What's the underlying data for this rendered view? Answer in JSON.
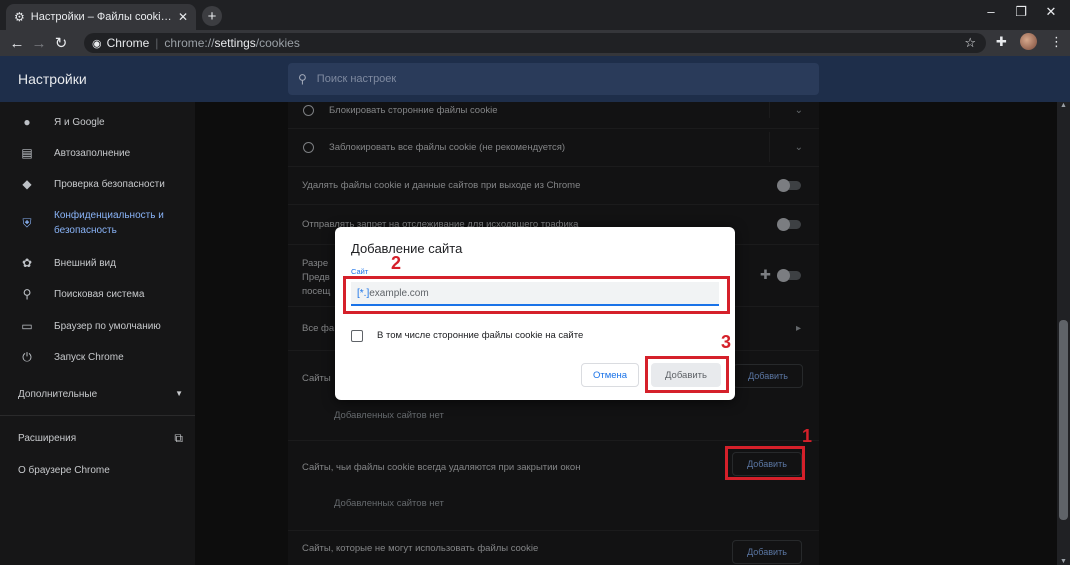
{
  "browser": {
    "tab_title": "Настройки – Файлы cookie и др",
    "tab_icon": "gear-icon",
    "new_tab_label": "+",
    "site_name": "Chrome",
    "url_prefix": "chrome://",
    "url_host": "settings",
    "url_path": "/cookies",
    "window_controls": [
      "–",
      "❐",
      "✕"
    ]
  },
  "settings": {
    "title": "Настройки",
    "search_placeholder": "Поиск настроек"
  },
  "sidebar": {
    "items": [
      {
        "label": "Я и Google",
        "icon": "person-icon"
      },
      {
        "label": "Автозаполнение",
        "icon": "clipboard-icon"
      },
      {
        "label": "Проверка безопасности",
        "icon": "shield-check-icon"
      },
      {
        "label": "Конфиденциальность и безопасность",
        "icon": "shield-icon",
        "active": true
      },
      {
        "label": "Внешний вид",
        "icon": "palette-icon"
      },
      {
        "label": "Поисковая система",
        "icon": "search-icon"
      },
      {
        "label": "Браузер по умолчанию",
        "icon": "browser-icon"
      },
      {
        "label": "Запуск Chrome",
        "icon": "power-icon"
      }
    ],
    "advanced": "Дополнительные",
    "extensions": "Расширения",
    "about": "О браузере Chrome"
  },
  "content": {
    "block_third_party": "Блокировать сторонние файлы cookie",
    "block_all": "Заблокировать все файлы cookie (не рекомендуется)",
    "clear_on_exit": "Удалять файлы cookie и данные сайтов при выходе из Chrome",
    "do_not_track": "Отправлять запрет на отслеживание для исходящего трафика",
    "preload_line1": "Разре",
    "preload_line2": "Предв",
    "preload_line3": "посещ",
    "all_cookies": "Все фа",
    "sites_allowed": "Сайты",
    "no_sites_1": "Добавленных сайтов нет",
    "clear_on_close": "Сайты, чьи файлы cookie всегда удаляются при закрытии окон",
    "no_sites_2": "Добавленных сайтов нет",
    "blocked_sites": "Сайты, которые не могут использовать файлы cookie",
    "add_label": "Добавить"
  },
  "dialog": {
    "title": "Добавление сайта",
    "field_label": "Сайт",
    "field_caret": "[*.]",
    "field_placeholder": "example.com",
    "checkbox_label": "В том числе сторонние файлы cookie на сайте",
    "cancel_label": "Отмена",
    "confirm_label": "Добавить"
  },
  "annotations": {
    "step1": "1",
    "step2": "2",
    "step3": "3",
    "color": "#d5202a"
  }
}
